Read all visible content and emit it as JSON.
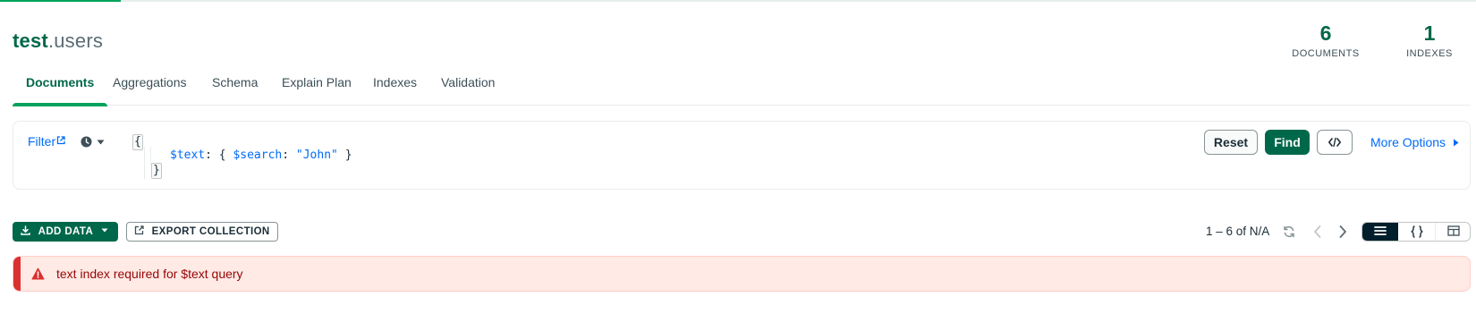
{
  "progress": {
    "fraction": 0.082
  },
  "header": {
    "database": "test",
    "separator": ".",
    "collection": "users"
  },
  "stats": {
    "documents": {
      "value": "6",
      "label": "DOCUMENTS"
    },
    "indexes": {
      "value": "1",
      "label": "INDEXES"
    }
  },
  "tabs": [
    {
      "label": "Documents",
      "active": true
    },
    {
      "label": "Aggregations",
      "active": false
    },
    {
      "label": "Schema",
      "active": false
    },
    {
      "label": "Explain Plan",
      "active": false
    },
    {
      "label": "Indexes",
      "active": false
    },
    {
      "label": "Validation",
      "active": false
    }
  ],
  "filter": {
    "label": "Filter",
    "query": {
      "open_brace": "{",
      "key": "$text",
      "colon": ": { ",
      "inner_key": "$search",
      "inner_colon": ": ",
      "value": "\"John\"",
      "inner_close": " }",
      "close_brace": "}"
    },
    "reset_label": "Reset",
    "find_label": "Find",
    "more_options_label": "More Options"
  },
  "toolbar": {
    "add_data_label": "ADD DATA",
    "export_label": "EXPORT COLLECTION",
    "pagination_text": "1 – 6 of N/A"
  },
  "alert": {
    "message": "text index required for $text query"
  },
  "colors": {
    "brand_green": "#00684a",
    "accent_green": "#00a35c",
    "link_blue": "#016bf8",
    "error_red": "#db3030",
    "error_bg": "#ffeae5"
  },
  "icons": {
    "external_link": "external-link-icon",
    "history": "clock-icon",
    "code": "code-brackets-icon",
    "add": "download-icon",
    "export": "export-icon",
    "refresh": "refresh-icon",
    "warning": "warning-icon"
  }
}
